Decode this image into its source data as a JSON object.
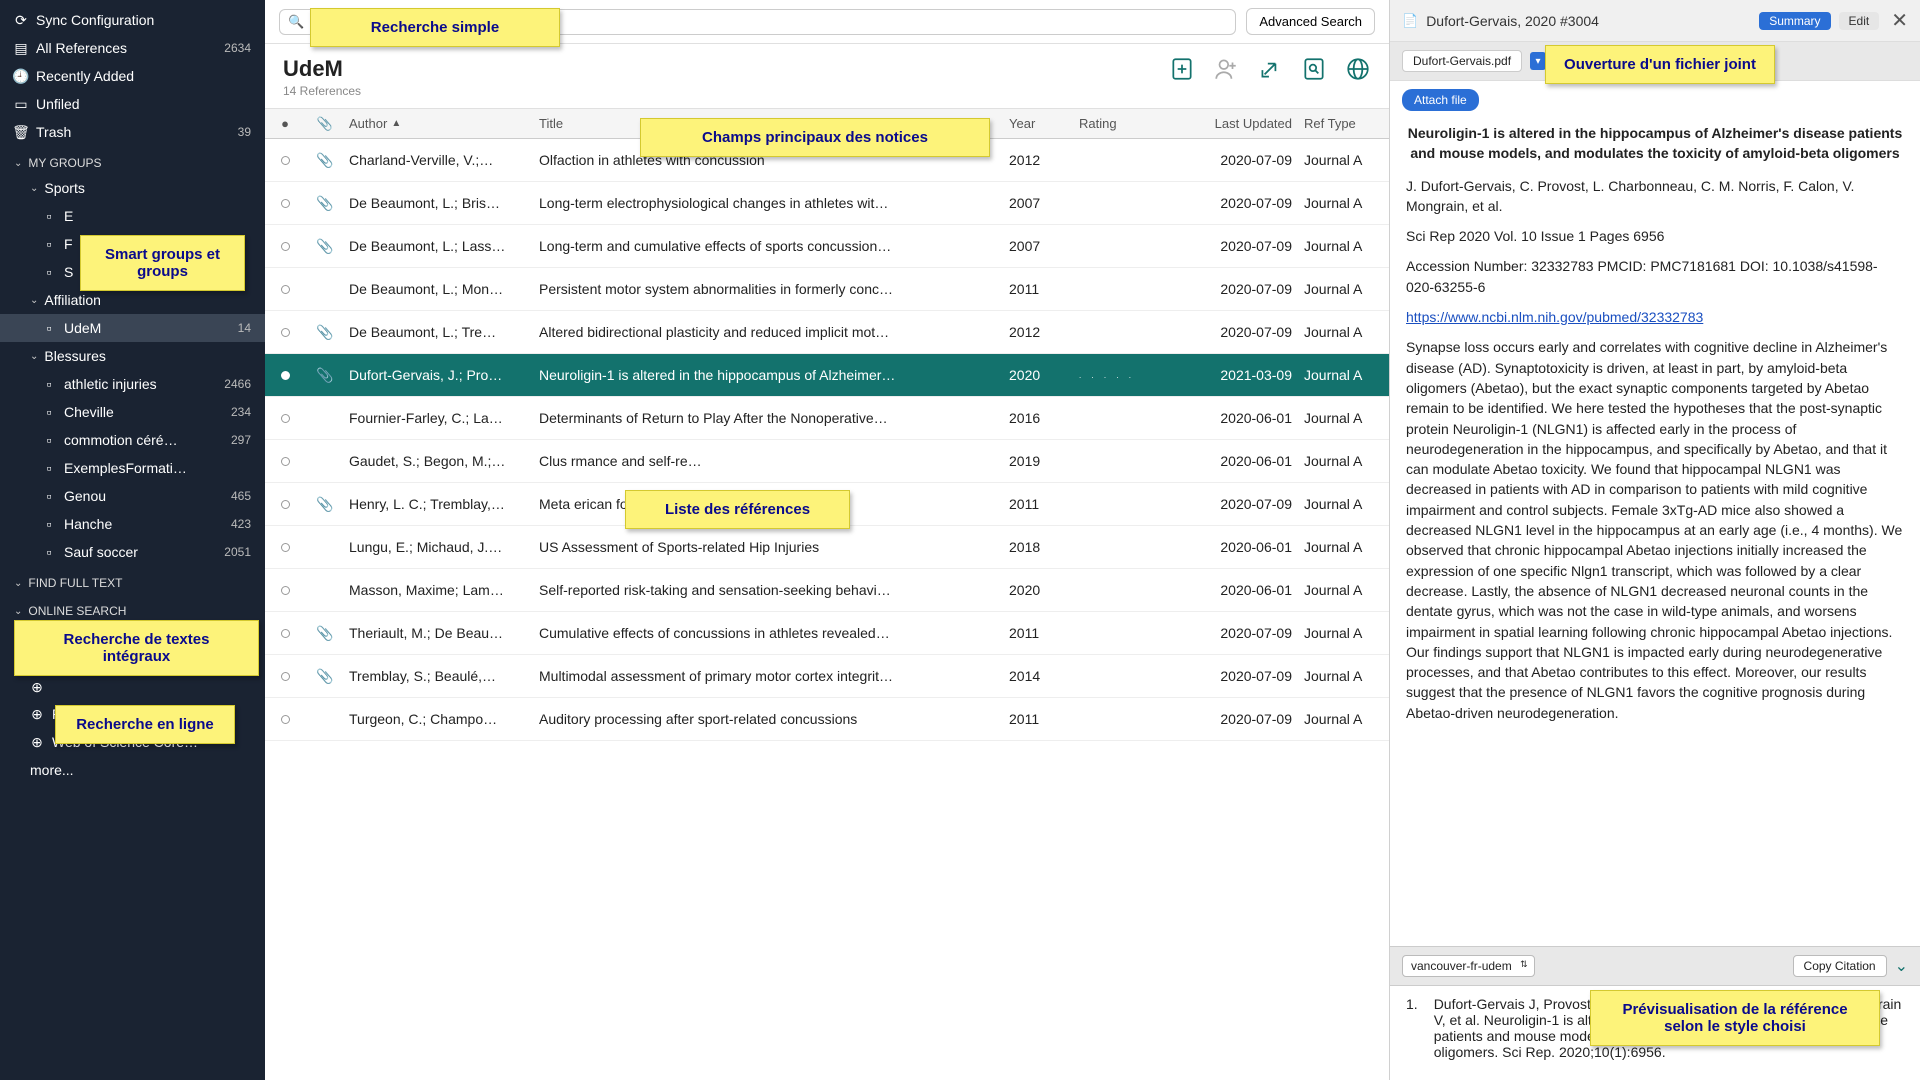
{
  "sidebar": {
    "sync": "Sync Configuration",
    "all": {
      "label": "All References",
      "count": "2634"
    },
    "recent": "Recently Added",
    "unfiled": "Unfiled",
    "trash": {
      "label": "Trash",
      "count": "39"
    },
    "mygroups": "MY GROUPS",
    "sports": "Sports",
    "affiliation": "Affiliation",
    "udem": {
      "label": "UdeM",
      "count": "14"
    },
    "blessures": "Blessures",
    "groups": [
      {
        "label": "athletic injuries",
        "count": "2466"
      },
      {
        "label": "Cheville",
        "count": "234"
      },
      {
        "label": "commotion céré…",
        "count": "297"
      },
      {
        "label": "ExemplesFormati…",
        "count": ""
      },
      {
        "label": "Genou",
        "count": "465"
      },
      {
        "label": "Hanche",
        "count": "423"
      },
      {
        "label": "Sauf soccer",
        "count": "2051"
      }
    ],
    "findfull": "FIND FULL TEXT",
    "online": "ONLINE SEARCH",
    "pubmed": "PubMed (NLM)",
    "wos": "Web of Science Core…",
    "more": "more..."
  },
  "toolbar": {
    "search_prefix": "Se",
    "adv": "Advanced Search"
  },
  "collection": {
    "title": "UdeM",
    "sub": "14 References"
  },
  "columns": {
    "author": "Author",
    "title": "Title",
    "year": "Year",
    "rating": "Rating",
    "updated": "Last Updated",
    "type": "Ref Type"
  },
  "rows": [
    {
      "clip": true,
      "author": "Charland-Verville, V.;…",
      "title": "Olfaction in athletes with concussion",
      "year": "2012",
      "updated": "2020-07-09",
      "type": "Journal A"
    },
    {
      "clip": true,
      "author": "De Beaumont, L.; Bris…",
      "title": "Long-term electrophysiological changes in athletes wit…",
      "year": "2007",
      "updated": "2020-07-09",
      "type": "Journal A"
    },
    {
      "clip": true,
      "author": "De Beaumont, L.; Lass…",
      "title": "Long-term and cumulative effects of sports concussion…",
      "year": "2007",
      "updated": "2020-07-09",
      "type": "Journal A"
    },
    {
      "clip": false,
      "author": "De Beaumont, L.; Mon…",
      "title": "Persistent motor system abnormalities in formerly conc…",
      "year": "2011",
      "updated": "2020-07-09",
      "type": "Journal A"
    },
    {
      "clip": true,
      "author": "De Beaumont, L.; Tre…",
      "title": "Altered bidirectional plasticity and reduced implicit mot…",
      "year": "2012",
      "updated": "2020-07-09",
      "type": "Journal A"
    },
    {
      "clip": true,
      "sel": true,
      "author": "Dufort-Gervais, J.; Pro…",
      "title": "Neuroligin-1 is altered in the hippocampus of Alzheimer…",
      "year": "2020",
      "rating": ". . . . .",
      "updated": "2021-03-09",
      "type": "Journal A"
    },
    {
      "clip": false,
      "author": "Fournier-Farley, C.; La…",
      "title": "Determinants of Return to Play After the Nonoperative…",
      "year": "2016",
      "updated": "2020-06-01",
      "type": "Journal A"
    },
    {
      "clip": false,
      "author": "Gaudet, S.; Begon, M.;…",
      "title": "Clus                                                           rmance and self-re…",
      "year": "2019",
      "updated": "2020-06-01",
      "type": "Journal A"
    },
    {
      "clip": true,
      "author": "Henry, L. C.; Tremblay,…",
      "title": "Meta                                                         erican football play…",
      "year": "2011",
      "updated": "2020-07-09",
      "type": "Journal A"
    },
    {
      "clip": false,
      "author": "Lungu, E.; Michaud, J.…",
      "title": "US Assessment of Sports-related Hip Injuries",
      "year": "2018",
      "updated": "2020-06-01",
      "type": "Journal A"
    },
    {
      "clip": false,
      "author": "Masson, Maxime; Lam…",
      "title": "Self-reported risk-taking and sensation-seeking behavi…",
      "year": "2020",
      "updated": "2020-06-01",
      "type": "Journal A"
    },
    {
      "clip": true,
      "author": "Theriault, M.; De Beau…",
      "title": "Cumulative effects of concussions in athletes revealed…",
      "year": "2011",
      "updated": "2020-07-09",
      "type": "Journal A"
    },
    {
      "clip": true,
      "author": "Tremblay, S.; Beaulé,…",
      "title": "Multimodal assessment of primary motor cortex integrit…",
      "year": "2014",
      "updated": "2020-07-09",
      "type": "Journal A"
    },
    {
      "clip": false,
      "author": "Turgeon, C.; Champo…",
      "title": "Auditory processing after sport-related concussions",
      "year": "2011",
      "updated": "2020-07-09",
      "type": "Journal A"
    }
  ],
  "detail": {
    "header": "Dufort-Gervais, 2020 #3004",
    "summary": "Summary",
    "edit": "Edit",
    "pdf": "Dufort-Gervais.pdf",
    "attach": "Attach file",
    "title": "Neuroligin-1 is altered in the hippocampus of Alzheimer's disease patients and mouse models, and modulates the toxicity of amyloid-beta oligomers",
    "authors": "J. Dufort-Gervais, C. Provost, L. Charbonneau, C. M. Norris, F. Calon, V. Mongrain, et al.",
    "journal": "Sci Rep 2020 Vol. 10 Issue 1 Pages 6956",
    "ids": "Accession Number: 32332783 PMCID: PMC7181681 DOI: 10.1038/s41598-020-63255-6",
    "url": "https://www.ncbi.nlm.nih.gov/pubmed/32332783",
    "abstract": "Synapse loss occurs early and correlates with cognitive decline in Alzheimer's disease (AD). Synaptotoxicity is driven, at least in part, by amyloid-beta oligomers (Abetao), but the exact synaptic components targeted by Abetao remain to be identified. We here tested the hypotheses that the post-synaptic protein Neuroligin-1 (NLGN1) is affected early in the process of neurodegeneration in the hippocampus, and specifically by Abetao, and that it can modulate Abetao toxicity. We found that hippocampal NLGN1 was decreased in patients with AD in comparison to patients with mild cognitive impairment and control subjects. Female 3xTg-AD mice also showed a decreased NLGN1 level in the hippocampus at an early age (i.e., 4 months). We observed that chronic hippocampal Abetao injections initially increased the expression of one specific Nlgn1 transcript, which was followed by a clear decrease. Lastly, the absence of NLGN1 decreased neuronal counts in the dentate gyrus, which was not the case in wild-type animals, and worsens impairment in spatial learning following chronic hippocampal Abetao injections. Our findings support that NLGN1 is impacted early during neurodegenerative processes, and that Abetao contributes to this effect. Moreover, our results suggest that the presence of NLGN1 favors the cognitive prognosis during Abetao-driven neurodegeneration.",
    "style": "vancouver-fr-udem",
    "copy": "Copy Citation",
    "cite_num": "1.",
    "cite_text": "Dufort-Gervais J, Provost C, Charbonneau L, Norris CM, Calon F, Mongrain V, et al. Neuroligin-1 is altered in the hippocampus of Alzheimer's disease patients and mouse models, and modulates the toxicity of amyloid-beta oligomers. Sci Rep. 2020;10(1):6956."
  },
  "callouts": {
    "search": "Recherche simple",
    "groups": "Smart groups et groups",
    "fulltext": "Recherche de textes intégraux",
    "online": "Recherche en ligne",
    "fields": "Champs principaux des notices",
    "list": "Liste des références",
    "attach": "Ouverture d'un fichier joint",
    "preview": "Prévisualisation de la référence selon le style choisi"
  }
}
